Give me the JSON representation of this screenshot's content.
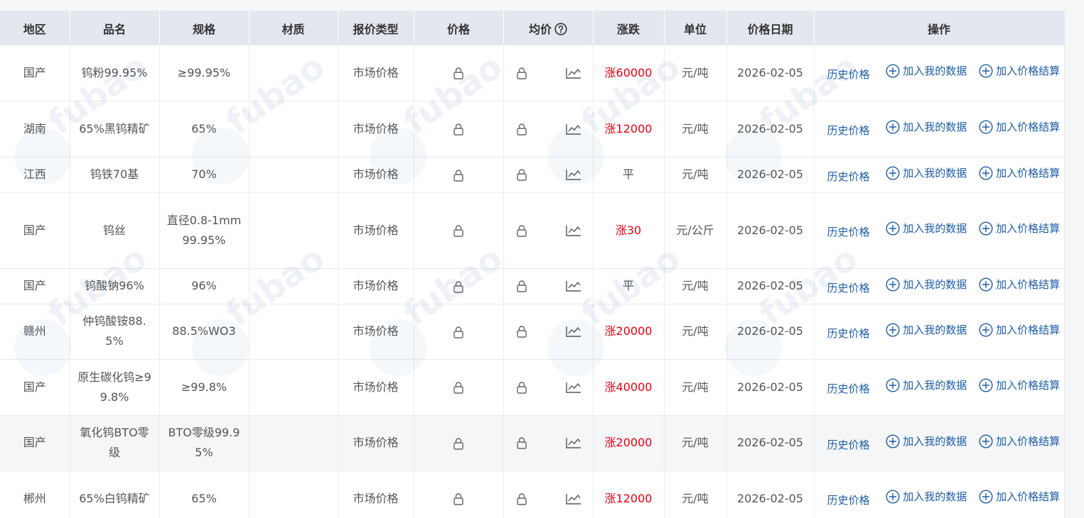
{
  "headers": {
    "region": "地区",
    "name": "品名",
    "spec": "规格",
    "material": "材质",
    "quote_type": "报价类型",
    "price": "价格",
    "avg_price": "均价",
    "change": "涨跌",
    "unit": "单位",
    "date": "价格日期",
    "actions": "操作"
  },
  "action_labels": {
    "history": "历史价格",
    "add_data": "加入我的数据",
    "add_settle": "加入价格结算"
  },
  "icons": {
    "price": "lock-icon",
    "avg": "lock-icon",
    "trend": "trend-chart-icon",
    "help": "help-circle-icon",
    "add": "plus-circle-icon"
  },
  "colors": {
    "up": "#e60012",
    "link": "#1d5da8",
    "header_bg": "#e3e7ef"
  },
  "rows": [
    {
      "region": "国产",
      "name": "钨粉99.95%",
      "spec": "≥99.95%",
      "material": "",
      "quote_type": "市场价格",
      "change": "涨60000",
      "dir": "up",
      "unit": "元/吨",
      "date": "2026-02-05"
    },
    {
      "region": "湖南",
      "name": "65%黑钨精矿",
      "spec": "65%",
      "material": "",
      "quote_type": "市场价格",
      "change": "涨12000",
      "dir": "up",
      "unit": "元/吨",
      "date": "2026-02-05"
    },
    {
      "region": "江西",
      "name": "钨铁70基",
      "spec": "70%",
      "material": "",
      "quote_type": "市场价格",
      "change": "平",
      "dir": "flat",
      "unit": "元/吨",
      "date": "2026-02-05"
    },
    {
      "region": "国产",
      "name": "钨丝",
      "spec": "直径0.8-1mm 99.95%",
      "material": "",
      "quote_type": "市场价格",
      "change": "涨30",
      "dir": "up",
      "unit": "元/公斤",
      "date": "2026-02-05"
    },
    {
      "region": "国产",
      "name": "钨酸钠96%",
      "spec": "96%",
      "material": "",
      "quote_type": "市场价格",
      "change": "平",
      "dir": "flat",
      "unit": "元/吨",
      "date": "2026-02-05"
    },
    {
      "region": "赣州",
      "name": "仲钨酸铵88.5%",
      "spec": "88.5%WO3",
      "material": "",
      "quote_type": "市场价格",
      "change": "涨20000",
      "dir": "up",
      "unit": "元/吨",
      "date": "2026-02-05"
    },
    {
      "region": "国产",
      "name": "原生碳化钨≥99.8%",
      "spec": "≥99.8%",
      "material": "",
      "quote_type": "市场价格",
      "change": "涨40000",
      "dir": "up",
      "unit": "元/吨",
      "date": "2026-02-05"
    },
    {
      "region": "国产",
      "name": "氧化钨BTO零级",
      "spec": "BTO零级99.95%",
      "material": "",
      "quote_type": "市场价格",
      "change": "涨20000",
      "dir": "up",
      "unit": "元/吨",
      "date": "2026-02-05",
      "highlight": true
    },
    {
      "region": "郴州",
      "name": "65%白钨精矿",
      "spec": "65%",
      "material": "",
      "quote_type": "市场价格",
      "change": "涨12000",
      "dir": "up",
      "unit": "元/吨",
      "date": "2026-02-05"
    }
  ]
}
